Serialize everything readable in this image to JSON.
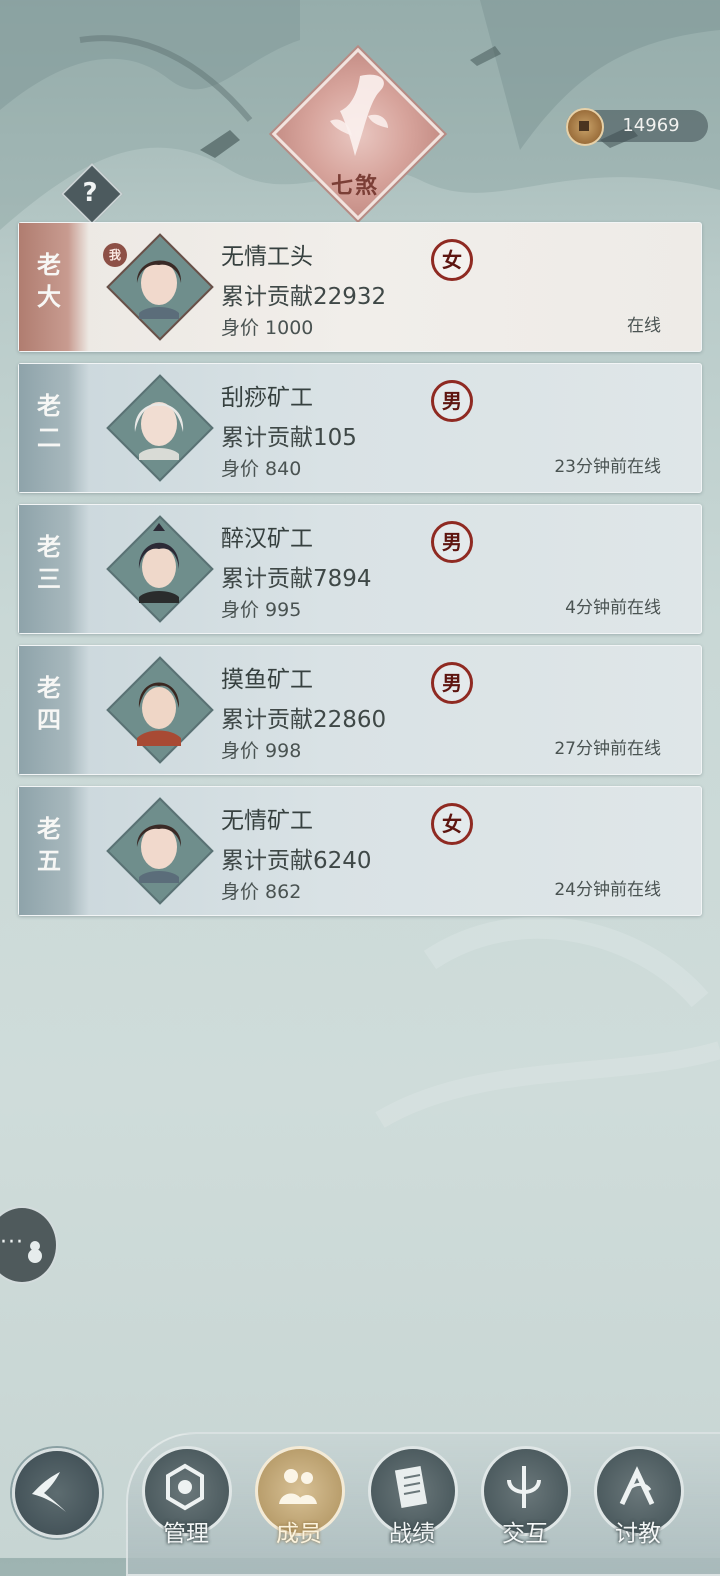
{
  "header": {
    "guild_name": "七煞",
    "emblem_icon": "flower-blade-icon",
    "help_icon": "question-icon",
    "currency": {
      "icon": "copper-coin-icon",
      "value": "14969"
    }
  },
  "members": [
    {
      "rank": "老大",
      "name": "无情工头",
      "contribution": "累计贡献22932",
      "price": "身价 1000",
      "gender": "女",
      "status": "在线",
      "is_self": true,
      "self_badge": "我"
    },
    {
      "rank": "老二",
      "name": "刮痧矿工",
      "contribution": "累计贡献105",
      "price": "身价 840",
      "gender": "男",
      "status": "23分钟前在线"
    },
    {
      "rank": "老三",
      "name": "醉汉矿工",
      "contribution": "累计贡献7894",
      "price": "身价 995",
      "gender": "男",
      "status": "4分钟前在线"
    },
    {
      "rank": "老四",
      "name": "摸鱼矿工",
      "contribution": "累计贡献22860",
      "price": "身价 998",
      "gender": "男",
      "status": "27分钟前在线"
    },
    {
      "rank": "老五",
      "name": "无情矿工",
      "contribution": "累计贡献6240",
      "price": "身价 862",
      "gender": "女",
      "status": "24分钟前在线"
    }
  ],
  "side": {
    "chat_icon": "chat-bubble-icon"
  },
  "nav": {
    "back_icon": "back-arrow-icon",
    "items": [
      {
        "label": "管理",
        "icon": "manage-icon",
        "active": false
      },
      {
        "label": "成员",
        "icon": "members-icon",
        "active": true
      },
      {
        "label": "战绩",
        "icon": "record-scroll-icon",
        "active": false
      },
      {
        "label": "交互",
        "icon": "interact-icon",
        "active": false
      },
      {
        "label": "讨教",
        "icon": "challenge-icon",
        "active": false
      }
    ]
  },
  "colors": {
    "self_tab": "#b07d70",
    "gender_ring": "#8f2a22",
    "active_nav": "#b79c6a"
  }
}
